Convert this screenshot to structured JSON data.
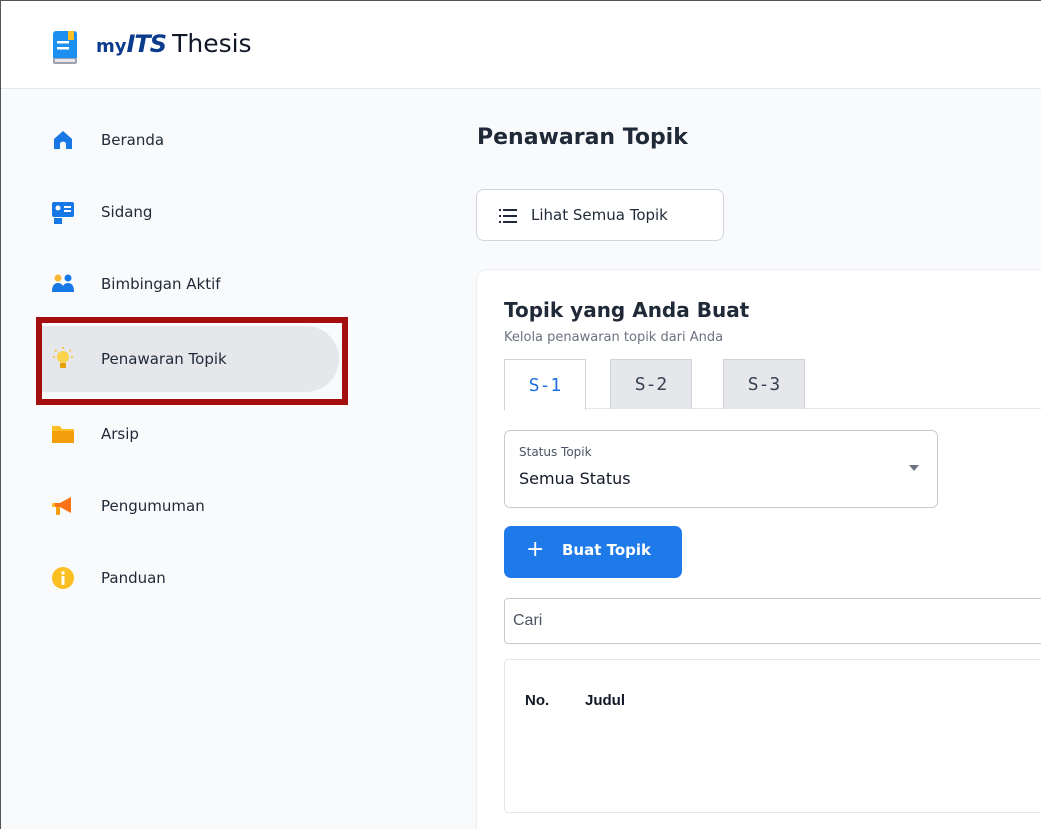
{
  "app": {
    "brand_my": "my",
    "brand_its": "ITS",
    "brand_thesis": "Thesis"
  },
  "sidebar": {
    "items": [
      {
        "label": "Beranda",
        "icon": "home-icon"
      },
      {
        "label": "Sidang",
        "icon": "id-card-icon"
      },
      {
        "label": "Bimbingan Aktif",
        "icon": "people-icon"
      },
      {
        "label": "Penawaran Topik",
        "icon": "lightbulb-icon",
        "active": true
      },
      {
        "label": "Arsip",
        "icon": "folder-icon"
      },
      {
        "label": "Pengumuman",
        "icon": "megaphone-icon"
      },
      {
        "label": "Panduan",
        "icon": "info-icon"
      }
    ]
  },
  "main": {
    "title": "Penawaran Topik",
    "view_all_label": "Lihat Semua Topik",
    "card": {
      "title": "Topik yang Anda Buat",
      "subtitle": "Kelola penawaran topik dari Anda",
      "tabs": [
        "S-1",
        "S-2",
        "S-3"
      ],
      "active_tab": "S-1",
      "status_select": {
        "label": "Status Topik",
        "value": "Semua Status"
      },
      "create_label": "Buat Topik",
      "search_placeholder": "Cari",
      "table": {
        "columns": [
          "No.",
          "Judul"
        ]
      }
    }
  },
  "colors": {
    "primary": "#1d7ae8",
    "brand_dark": "#0b3b8c",
    "highlight": "#a50f0f"
  }
}
